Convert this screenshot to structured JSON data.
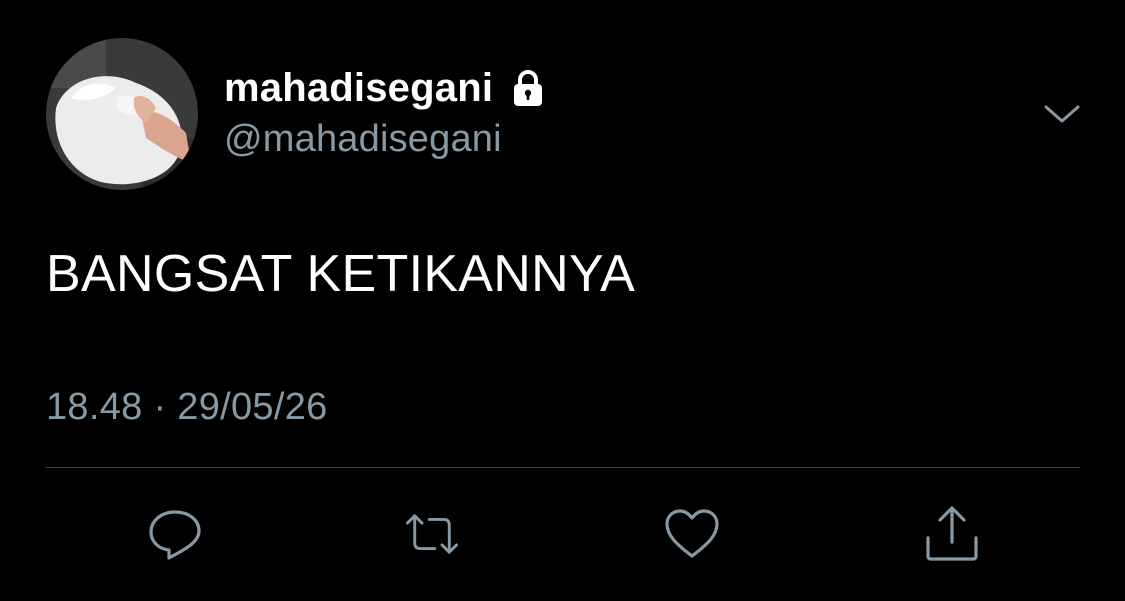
{
  "tweet": {
    "author": {
      "display_name": "mahadisegani",
      "handle": "@mahadisegani",
      "protected_icon": "lock-icon"
    },
    "text": "BANGSAT KETIKANNYA",
    "timestamp": "18.48 · 29/05/26"
  },
  "menu": {
    "icon": "chevron-down-icon"
  },
  "actions": [
    {
      "name": "reply",
      "icon": "reply-icon"
    },
    {
      "name": "retweet",
      "icon": "retweet-icon"
    },
    {
      "name": "like",
      "icon": "heart-icon"
    },
    {
      "name": "share",
      "icon": "share-icon"
    }
  ],
  "colors": {
    "background": "#000000",
    "primary_text": "#ffffff",
    "secondary_text": "#8899a6",
    "divider": "#38444d",
    "icon": "#8899a6"
  }
}
